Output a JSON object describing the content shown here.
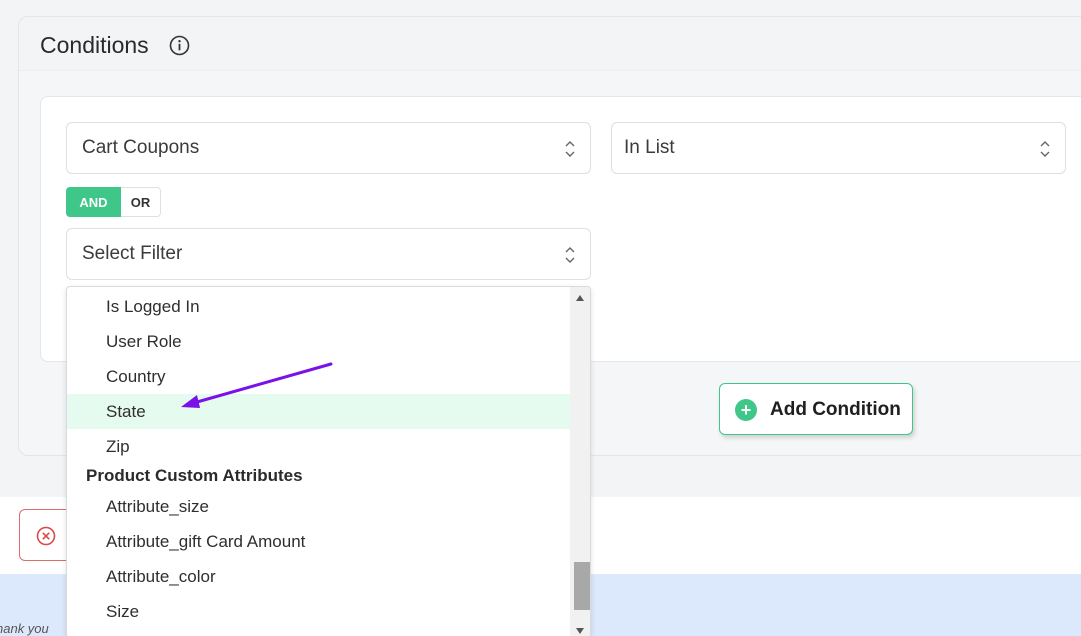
{
  "conditions": {
    "title": "Conditions",
    "info_icon": "info-circle-icon",
    "condition_type": "Cart Coupons",
    "operator": "In List",
    "logic": {
      "and_label": "AND",
      "or_label": "OR",
      "active": "AND"
    },
    "filter_select": {
      "value": "Select Filter"
    },
    "add_button_label": "Add Condition"
  },
  "dropdown": {
    "items_top": [
      "Is Logged In",
      "User Role",
      "Country",
      "State",
      "Zip"
    ],
    "highlighted": "State",
    "group_label": "Product Custom Attributes",
    "items_group": [
      "Attribute_size",
      "Attribute_gift Card Amount",
      "Attribute_color",
      "Size"
    ]
  },
  "footer": {
    "thank_you_partial": "hank you"
  },
  "colors": {
    "accent_green": "#3ec788",
    "highlight_bg": "#e5fbef",
    "error_red": "#e06b6b",
    "annotation_arrow": "#7a12e8",
    "footer_blue": "#dce8fb"
  }
}
